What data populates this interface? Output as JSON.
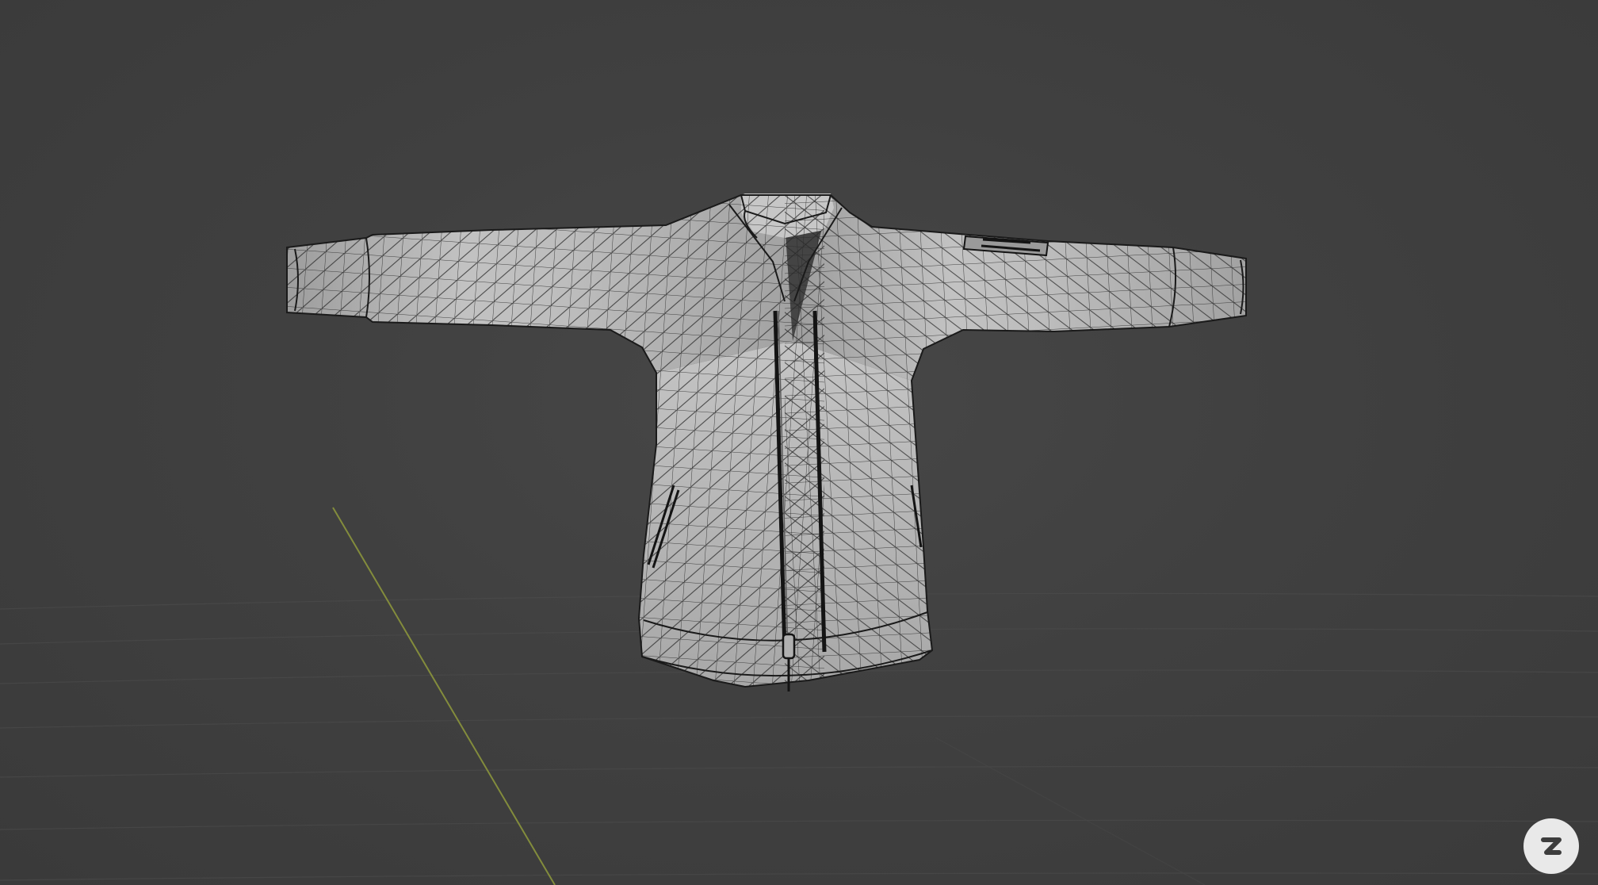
{
  "app": {
    "view_mode": "wireframe-over-solid",
    "background_color": "#3d3d3d",
    "mesh_fill_color": "#b9b9b9",
    "wire_color": "#1c1c1c",
    "grid_color": "#4a4a4a",
    "y_axis_color": "#8f9a3c"
  },
  "viewport": {
    "object_icon": "jacket-mesh",
    "grid_visible": true,
    "axis_visible": "y-axis"
  },
  "logo": {
    "icon": "z-logo-icon",
    "badge_color": "#e9e9e9"
  }
}
